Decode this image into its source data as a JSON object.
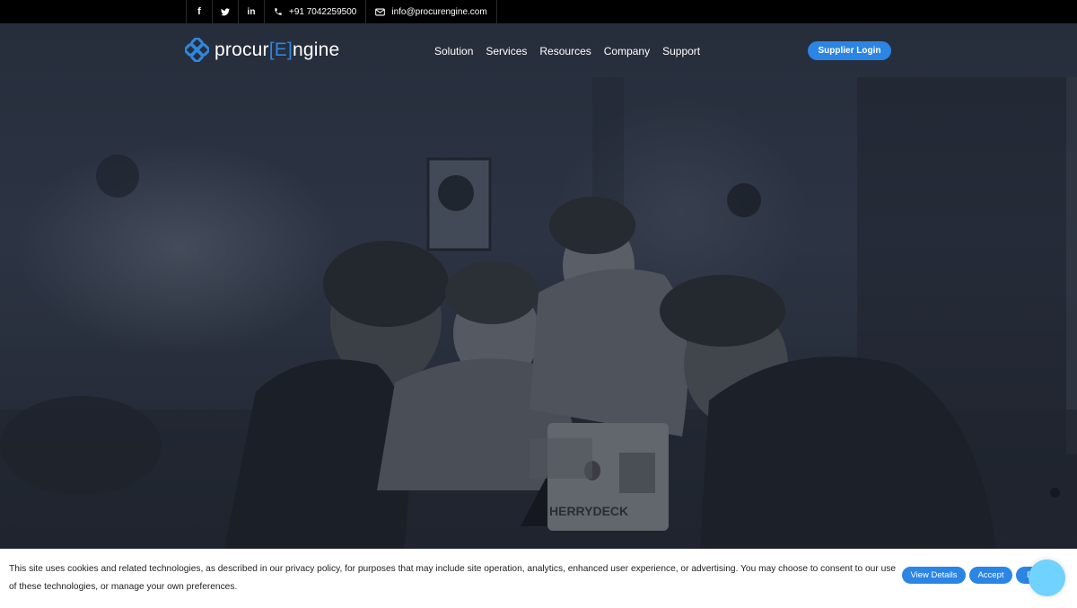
{
  "topbar": {
    "social": [
      {
        "icon": "facebook-icon",
        "glyph": "f"
      },
      {
        "icon": "twitter-icon"
      },
      {
        "icon": "linkedin-icon",
        "glyph": "in"
      }
    ],
    "phone": {
      "icon": "phone-icon",
      "text": "+91 7042259500"
    },
    "email": {
      "icon": "mail-icon",
      "text": "info@procurengine.com"
    }
  },
  "header": {
    "logo": {
      "part1": "procur",
      "open": "[",
      "letter": "E",
      "close": "]",
      "part2": "ngine",
      "icon": "procurengine-logo-icon"
    },
    "nav": [
      "Solution",
      "Services",
      "Resources",
      "Company",
      "Support"
    ],
    "supplier_login": "Supplier Login"
  },
  "hero": {
    "laptop_sticker": "HERRYDECK"
  },
  "cookie": {
    "text": "This site uses cookies and related technologies, as described in our privacy policy, for purposes that may include site operation, analytics, enhanced user experience, or advertising. You may choose to consent to our use of these technologies, or manage your own preferences.",
    "view_details": "View Details",
    "accept": "Accept",
    "decline_partial": "D"
  },
  "colors": {
    "accent": "#2b85e4",
    "topbar": "#000000",
    "hero_overlay": "#262d3b",
    "chat": "#6fd2ff"
  }
}
